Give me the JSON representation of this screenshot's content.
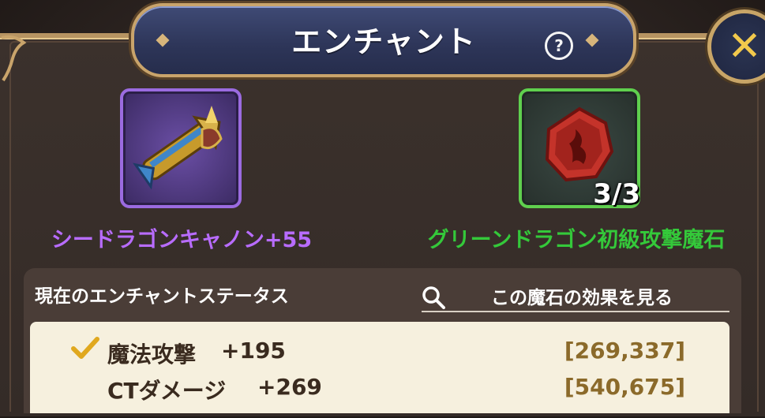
{
  "header": {
    "title": "エンチャント",
    "help_label": "?",
    "close_label": "✕"
  },
  "target_item": {
    "name": "シードラゴンキャノン+55",
    "icon": "cannon-weapon-icon",
    "frame_color": "#9b6be0",
    "name_color": "#b86cff"
  },
  "material_item": {
    "name": "グリーンドラゴン初級攻撃魔石",
    "icon": "red-magic-stone-icon",
    "count": "3/3",
    "frame_color": "#5fd04e",
    "name_color": "#34c93a"
  },
  "status": {
    "title": "現在のエンチャントステータス",
    "effect_link": "この魔石の効果を見る",
    "rows": [
      {
        "name": "魔法攻撃",
        "bonus": "+195",
        "range": "[269,337]",
        "checked": true
      },
      {
        "name": "CTダメージ",
        "bonus": "+269",
        "range": "[540,675]",
        "checked": false
      }
    ]
  },
  "colors": {
    "accent_gold": "#c9a46b",
    "banner_blue": "#2d3558",
    "range_text": "#8b6a2a"
  }
}
